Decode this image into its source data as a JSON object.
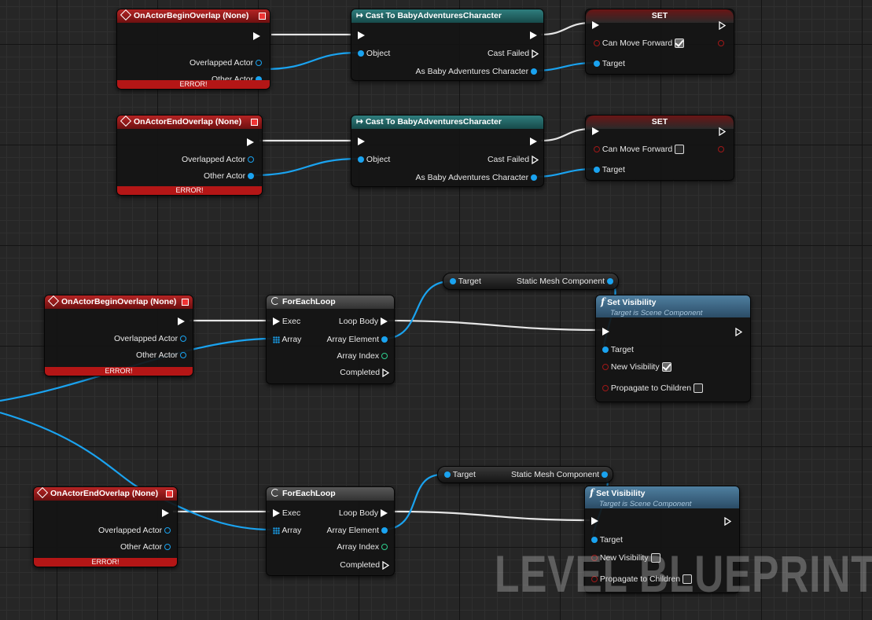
{
  "colors": {
    "object_pin": "#1aa3f0",
    "bool_pin": "#a01818",
    "int_pin": "#2ecf8e",
    "event_header": "#b52424",
    "cast_header": "#2f7d7d",
    "function_header": "#4f7fa0"
  },
  "watermark": "LEVEL BLUEPRINT",
  "icons": {
    "event": "diamond-icon",
    "cast": "cast-arrow-icon",
    "loop": "loop-icon",
    "function": "function-icon"
  },
  "events": {
    "begin1": {
      "title": "OnActorBeginOverlap (None)",
      "overlapped": "Overlapped Actor",
      "other": "Other Actor",
      "error": "ERROR!"
    },
    "end1": {
      "title": "OnActorEndOverlap (None)",
      "overlapped": "Overlapped Actor",
      "other": "Other Actor",
      "error": "ERROR!"
    },
    "begin2": {
      "title": "OnActorBeginOverlap (None)",
      "overlapped": "Overlapped Actor",
      "other": "Other Actor",
      "error": "ERROR!"
    },
    "end2": {
      "title": "OnActorEndOverlap (None)",
      "overlapped": "Overlapped Actor",
      "other": "Other Actor",
      "error": "ERROR!"
    }
  },
  "casts": {
    "c1": {
      "title": "Cast To BabyAdventuresCharacter",
      "object": "Object",
      "failed": "Cast Failed",
      "as": "As Baby Adventures Character"
    },
    "c2": {
      "title": "Cast To BabyAdventuresCharacter",
      "object": "Object",
      "failed": "Cast Failed",
      "as": "As Baby Adventures Character"
    }
  },
  "sets": {
    "s1": {
      "title": "SET",
      "prop": "Can Move Forward",
      "checked": true,
      "target": "Target"
    },
    "s2": {
      "title": "SET",
      "prop": "Can Move Forward",
      "checked": false,
      "target": "Target"
    }
  },
  "loops": {
    "l1": {
      "title": "ForEachLoop",
      "exec": "Exec",
      "array": "Array",
      "loop_body": "Loop Body",
      "element": "Array Element",
      "index": "Array Index",
      "completed": "Completed"
    },
    "l2": {
      "title": "ForEachLoop",
      "exec": "Exec",
      "array": "Array",
      "loop_body": "Loop Body",
      "element": "Array Element",
      "index": "Array Index",
      "completed": "Completed"
    }
  },
  "getters": {
    "g1": {
      "target": "Target",
      "output": "Static Mesh Component"
    },
    "g2": {
      "target": "Target",
      "output": "Static Mesh Component"
    }
  },
  "setvis": {
    "v1": {
      "title": "Set Visibility",
      "subtitle": "Target is Scene Component",
      "target": "Target",
      "new_visibility": "New Visibility",
      "new_visibility_checked": true,
      "propagate": "Propagate to Children",
      "propagate_checked": false
    },
    "v2": {
      "title": "Set Visibility",
      "subtitle": "Target is Scene Component",
      "target": "Target",
      "new_visibility": "New Visibility",
      "new_visibility_checked": false,
      "propagate": "Propagate to Children",
      "propagate_checked": false
    }
  }
}
